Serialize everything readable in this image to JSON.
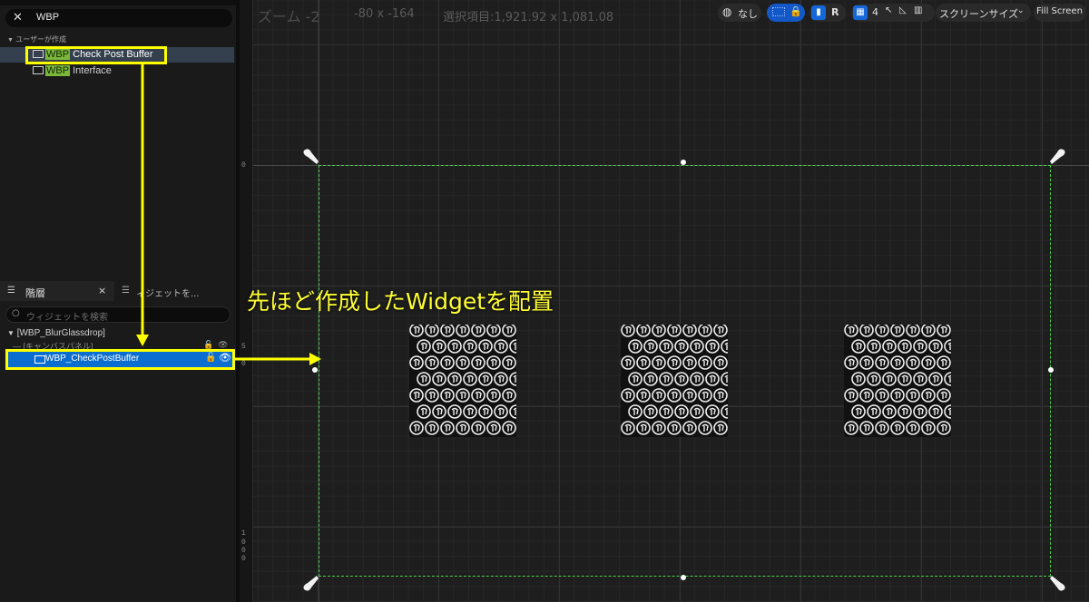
{
  "content_browser": {
    "search_value": "WBP",
    "category_label": "ユーザーが作成",
    "assets": [
      {
        "prefix": "WBP",
        "name": "Check Post Buffer"
      },
      {
        "prefix": "WBP",
        "name": "Interface"
      }
    ]
  },
  "hierarchy": {
    "tab_label": "階層",
    "tab2_label": "ィジェットを...",
    "search_placeholder": "ウィジェットを検索",
    "root_label": "[WBP_BlurGlassdrop]",
    "child_label": "[キャンバスパネル]",
    "selected_label": "WBP_CheckPostBuffer"
  },
  "viewport": {
    "zoom_label": "ズーム -2",
    "offset_label": "-80 x -164",
    "selection_label": "選択項目:1,921.92 x 1,081.08",
    "toolbar": {
      "none_label": "なし",
      "r_label": "R",
      "grid_count": "4",
      "screen_size_label": "スクリーンサイズ",
      "fill_screen_label": "Fill Screen"
    },
    "ruler_top": "0",
    "ruler_mid": [
      "5",
      "0"
    ],
    "ruler_bottom": [
      "1",
      "0",
      "0",
      "0"
    ]
  },
  "annotation": {
    "text": "先ほど作成したWidgetを配置",
    "color": "#ffff33"
  },
  "colors": {
    "accent_green": "#4bd04b",
    "selection_blue": "#0a6ed1",
    "highlight_yellow": "#ffff00",
    "prefix_green": "#7bb83a"
  }
}
